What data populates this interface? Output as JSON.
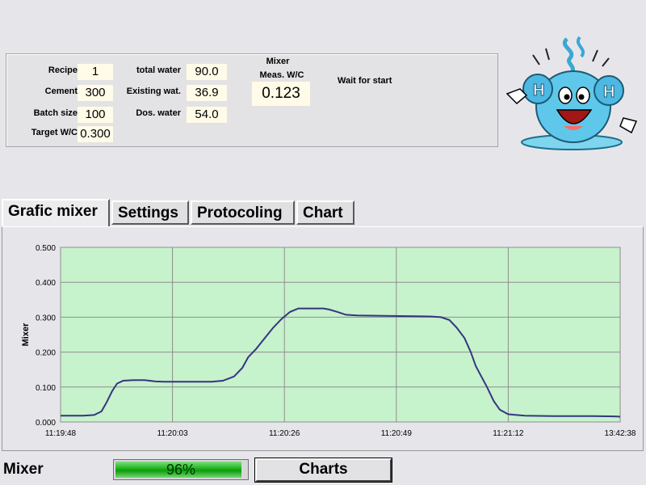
{
  "info_panel": {
    "recipe_label": "Recipe",
    "recipe_value": "1",
    "cement_label": "Cement",
    "cement_value": "300",
    "batch_label": "Batch size",
    "batch_value": "100",
    "target_label": "Target W/C",
    "target_value": "0.300",
    "total_water_label": "total water",
    "total_water_value": "90.0",
    "existing_label": "Existing wat.",
    "existing_value": "36.9",
    "dos_label": "Dos. water",
    "dos_value": "54.0",
    "mixer_label": "Mixer",
    "meas_label": "Meas. W/C",
    "meas_value": "0.123",
    "status_text": "Wait for start"
  },
  "mascot": {
    "icon": "water-drop-mascot-icon"
  },
  "tabs": [
    {
      "label": "Grafic mixer",
      "active": true
    },
    {
      "label": "Settings",
      "active": false
    },
    {
      "label": "Protocoling",
      "active": false
    },
    {
      "label": "Chart",
      "active": false
    }
  ],
  "chart_data": {
    "type": "line",
    "ylabel": "Mixer",
    "xlabel": "",
    "ylim": [
      0,
      0.5
    ],
    "yticks": [
      "0.000",
      "0.100",
      "0.200",
      "0.300",
      "0.400",
      "0.500"
    ],
    "xticks": [
      "11:19:48",
      "11:20:03",
      "11:20:26",
      "11:20:49",
      "11:21:12",
      "13:42:38"
    ],
    "x_range": [
      0,
      1
    ],
    "grid": true,
    "background_color": "#c6f2cc",
    "line_color": "#353580",
    "series": [
      {
        "points": [
          [
            0.0,
            0.018
          ],
          [
            0.04,
            0.018
          ],
          [
            0.06,
            0.02
          ],
          [
            0.073,
            0.03
          ],
          [
            0.082,
            0.055
          ],
          [
            0.092,
            0.088
          ],
          [
            0.101,
            0.11
          ],
          [
            0.112,
            0.118
          ],
          [
            0.13,
            0.12
          ],
          [
            0.15,
            0.12
          ],
          [
            0.17,
            0.116
          ],
          [
            0.185,
            0.115
          ],
          [
            0.23,
            0.115
          ],
          [
            0.27,
            0.115
          ],
          [
            0.29,
            0.118
          ],
          [
            0.31,
            0.13
          ],
          [
            0.325,
            0.155
          ],
          [
            0.335,
            0.185
          ],
          [
            0.35,
            0.21
          ],
          [
            0.365,
            0.24
          ],
          [
            0.38,
            0.27
          ],
          [
            0.395,
            0.295
          ],
          [
            0.41,
            0.315
          ],
          [
            0.425,
            0.325
          ],
          [
            0.47,
            0.325
          ],
          [
            0.48,
            0.322
          ],
          [
            0.495,
            0.315
          ],
          [
            0.51,
            0.307
          ],
          [
            0.53,
            0.305
          ],
          [
            0.58,
            0.304
          ],
          [
            0.62,
            0.303
          ],
          [
            0.66,
            0.302
          ],
          [
            0.68,
            0.3
          ],
          [
            0.695,
            0.292
          ],
          [
            0.708,
            0.27
          ],
          [
            0.722,
            0.24
          ],
          [
            0.733,
            0.2
          ],
          [
            0.742,
            0.16
          ],
          [
            0.752,
            0.13
          ],
          [
            0.762,
            0.1
          ],
          [
            0.774,
            0.06
          ],
          [
            0.785,
            0.035
          ],
          [
            0.8,
            0.022
          ],
          [
            0.83,
            0.018
          ],
          [
            0.88,
            0.017
          ],
          [
            0.95,
            0.017
          ],
          [
            0.99,
            0.016
          ],
          [
            1.0,
            0.015
          ]
        ]
      }
    ]
  },
  "bottom": {
    "mixer_label": "Mixer",
    "progress": 96,
    "progress_text": "96%",
    "charts_label": "Charts"
  }
}
